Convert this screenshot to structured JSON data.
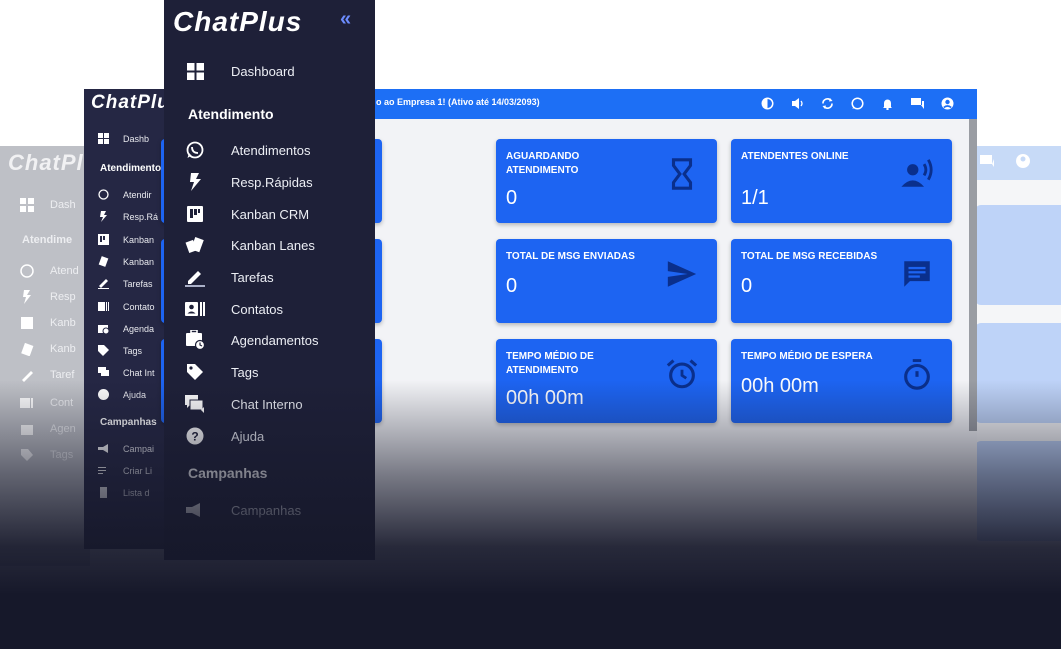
{
  "brand": {
    "logo": "ChatPlus"
  },
  "front_sidebar": {
    "items": [
      {
        "label": "Dashboard",
        "icon": "dashboard-icon"
      },
      {
        "label": "Atendimentos",
        "icon": "whatsapp-icon"
      },
      {
        "label": "Resp.Rápidas",
        "icon": "bolt-icon"
      },
      {
        "label": "Kanban CRM",
        "icon": "kanban-icon"
      },
      {
        "label": "Kanban Lanes",
        "icon": "lanes-icon"
      },
      {
        "label": "Tarefas",
        "icon": "pencil-icon"
      },
      {
        "label": "Contatos",
        "icon": "contacts-icon"
      },
      {
        "label": "Agendamentos",
        "icon": "schedule-icon"
      },
      {
        "label": "Tags",
        "icon": "tag-icon"
      },
      {
        "label": "Chat Interno",
        "icon": "chat-icon"
      },
      {
        "label": "Ajuda",
        "icon": "help-icon"
      },
      {
        "label": "Campanhas",
        "icon": "megaphone-icon"
      }
    ],
    "section_atendimento": "Atendimento",
    "section_campanhas": "Campanhas",
    "collapse": "«"
  },
  "mid_sidebar": {
    "items": [
      "Dashb",
      "Atendir",
      "Resp.Rá",
      "Kanban",
      "Kanban",
      "Tarefas",
      "Contato",
      "Agenda",
      "Tags",
      "Chat Int",
      "Ajuda",
      "Campai",
      "Criar Li",
      "Lista d"
    ],
    "section_atendimento": "Atendimento",
    "section_campanhas": "Campanhas"
  },
  "back_sidebar": {
    "items": [
      "Dash",
      "Atend",
      "Resp",
      "Kanb",
      "Kanb",
      "Taref",
      "Cont",
      "Agen",
      "Tags"
    ],
    "section_atendimento": "Atendime"
  },
  "topbar": {
    "text": "o ao Empresa 1! (Ativo até 14/03/2093)",
    "icons": [
      "brightness-icon",
      "volume-icon",
      "refresh-icon",
      "whatsapp-icon",
      "bell-icon",
      "chat-icon",
      "account-icon"
    ]
  },
  "cards": [
    {
      "title": "Aguardando Atendimento",
      "value": "0",
      "icon": "hourglass-icon"
    },
    {
      "title": "Atendentes Online",
      "value": "1/1",
      "icon": "person-voice-icon"
    },
    {
      "title": "Total de MSG Enviadas",
      "value": "0",
      "icon": "send-icon"
    },
    {
      "title": "Total de MSG Recebidas",
      "value": "0",
      "icon": "message-icon"
    },
    {
      "title": "Tempo Médio de Atendimento",
      "value": "00h 00m",
      "icon": "alarm-icon"
    },
    {
      "title": "Tempo Médio de Espera",
      "value": "00h 00m",
      "icon": "timer-icon"
    }
  ],
  "colors": {
    "accent": "#1d64f2",
    "sidebar": "#1e2038",
    "topbar": "#1d6ff5"
  }
}
